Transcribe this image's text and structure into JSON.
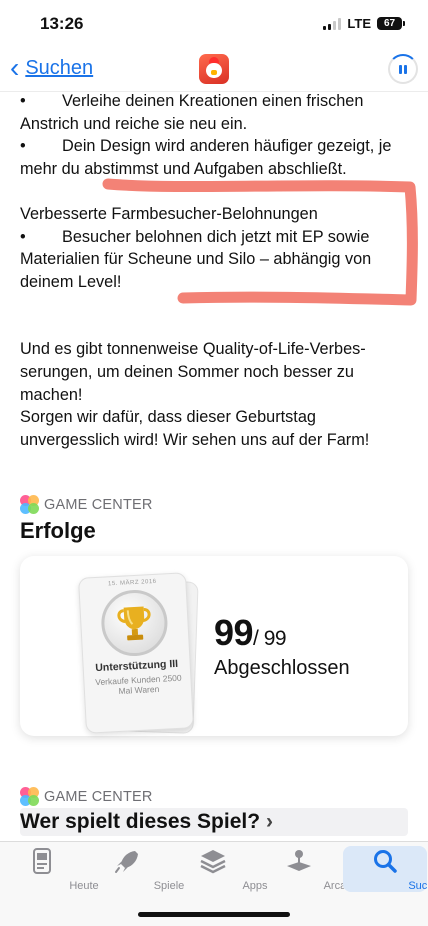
{
  "status": {
    "time": "13:26",
    "network": "LTE",
    "battery": "67"
  },
  "nav": {
    "back_label": "Suchen"
  },
  "description": {
    "line1": "Verleihe deinen Kreationen einen frischen",
    "line2": "Anstrich und reiche sie neu ein.",
    "line3": "Dein Design wird anderen häufiger gezeigt, je",
    "line4": "mehr du abstimmst und Aufgaben abschließt.",
    "line5": "Verbesserte Farmbesucher-Belohnungen",
    "line6": "Besucher belohnen dich jetzt mit EP sowie",
    "line7": "Materialien für Scheune und Silo – abhängig von",
    "line8": "deinem Level!",
    "line9": "Und es gibt tonnenweise Quality-of-Life-Verbes-",
    "line10": "serungen, um deinen Sommer noch besser zu",
    "line11": "machen!",
    "line12": "Sorgen wir dafür, dass dieser Geburtstag",
    "line13": "unvergesslich wird! Wir sehen uns auf der Farm!",
    "bullet": "•"
  },
  "achievements": {
    "source_label": "GAME CENTER",
    "title": "Erfolge",
    "badge_date": "15. MÄRZ 2016",
    "badge_title": "Unterstützung III",
    "badge_sub": "Verkaufe Kunden 2500 Mal Waren",
    "completed": "99",
    "total": "/ 99",
    "completed_label": "Abgeschlossen"
  },
  "who_plays": {
    "source_label": "GAME CENTER",
    "title": "Wer spielt dieses Spiel?",
    "chevron": "›"
  },
  "tabs": [
    {
      "label": "Heute",
      "icon": "today-icon",
      "active": false
    },
    {
      "label": "Spiele",
      "icon": "rocket-icon",
      "active": false
    },
    {
      "label": "Apps",
      "icon": "apps-stack-icon",
      "active": false
    },
    {
      "label": "Arcade",
      "icon": "joystick-icon",
      "active": false
    },
    {
      "label": "Suchen",
      "icon": "search-icon",
      "active": true
    }
  ],
  "colors": {
    "accent": "#1a73e8",
    "marker": "#f2776a",
    "gold": "#e8b020"
  }
}
